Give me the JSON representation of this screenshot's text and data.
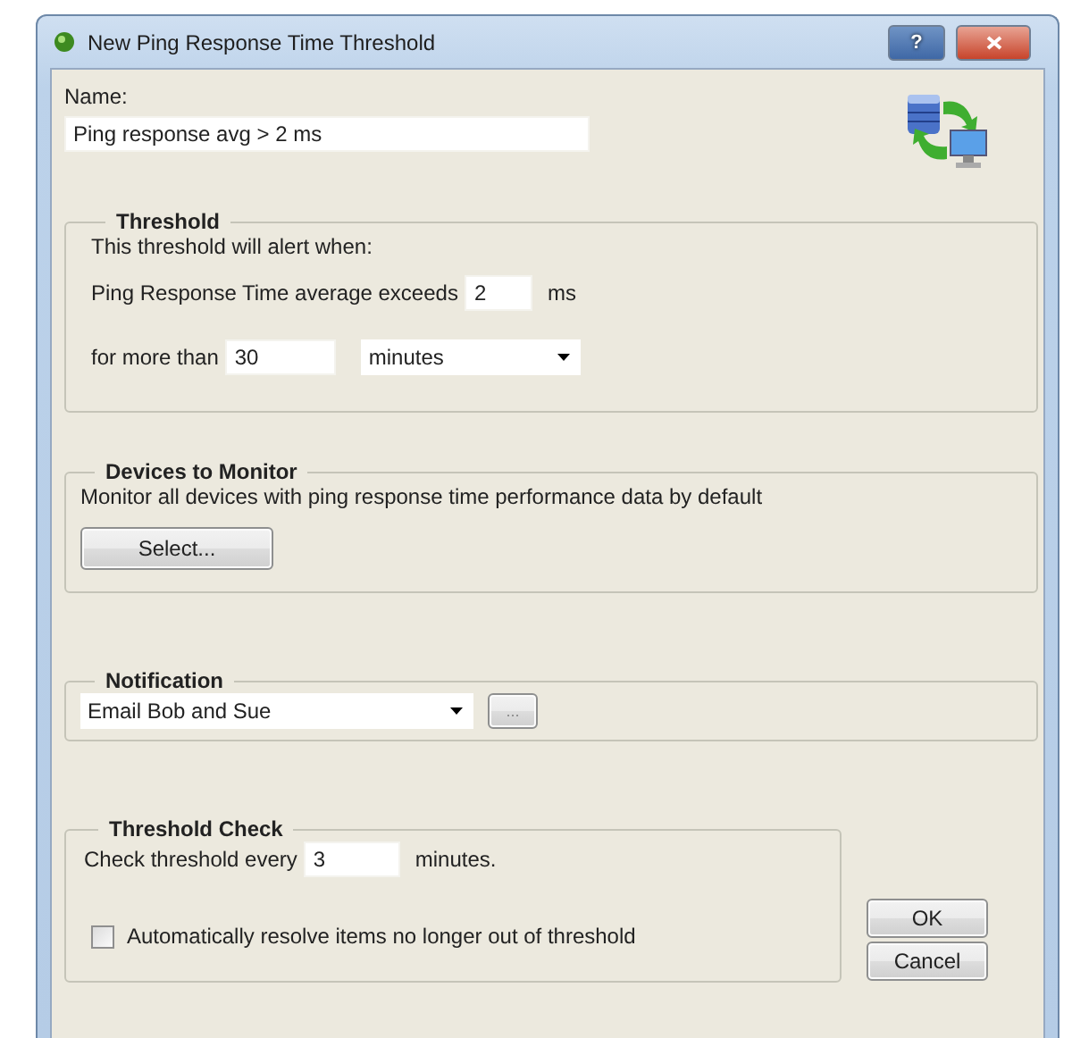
{
  "window": {
    "title": "New Ping Response Time Threshold",
    "help_button": "?"
  },
  "name": {
    "label": "Name:",
    "value": "Ping response avg > 2 ms"
  },
  "threshold": {
    "title": "Threshold",
    "intro": "This threshold will alert when:",
    "exceeds_label": "Ping Response Time average exceeds",
    "exceeds_value": "2",
    "exceeds_unit": "ms",
    "duration_label": "for more than",
    "duration_value": "30",
    "duration_unit": "minutes"
  },
  "devices": {
    "title": "Devices to Monitor",
    "description": "Monitor all devices with ping response time performance data by default",
    "button": "Select..."
  },
  "notification": {
    "title": "Notification",
    "value": "Email Bob and Sue",
    "button": "..."
  },
  "threshold_check": {
    "title": "Threshold Check",
    "label": "Check threshold every",
    "value": "3",
    "unit": "minutes.",
    "auto_resolve": {
      "label": "Automatically resolve items no longer out of threshold",
      "checked": false
    }
  },
  "buttons": [
    "OK",
    "Cancel"
  ]
}
